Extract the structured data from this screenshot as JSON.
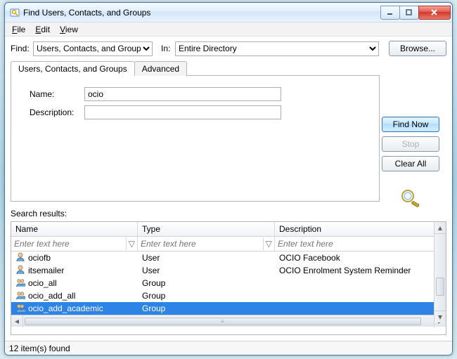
{
  "window": {
    "title": "Find Users, Contacts, and Groups"
  },
  "menu": {
    "file": "File",
    "edit": "Edit",
    "view": "View"
  },
  "find": {
    "label": "Find:",
    "value": "Users, Contacts, and Groups",
    "in_label": "In:",
    "in_value": "Entire Directory",
    "browse": "Browse..."
  },
  "tabs": {
    "main": "Users, Contacts, and Groups",
    "advanced": "Advanced"
  },
  "fields": {
    "name_label": "Name:",
    "name_value": "ocio",
    "desc_label": "Description:",
    "desc_value": ""
  },
  "buttons": {
    "find_now": "Find Now",
    "stop": "Stop",
    "clear_all": "Clear All"
  },
  "search_results_label": "Search results:",
  "columns": {
    "name": "Name",
    "type": "Type",
    "desc": "Description"
  },
  "filters": {
    "placeholder": "Enter text here"
  },
  "rows": [
    {
      "name": "ociofb",
      "type": "User",
      "desc": "OCIO Facebook",
      "icon": "user",
      "selected": false
    },
    {
      "name": "itsemailer",
      "type": "User",
      "desc": "OCIO Enrolment System Reminder",
      "icon": "user",
      "selected": false
    },
    {
      "name": "ocio_all",
      "type": "Group",
      "desc": "",
      "icon": "group",
      "selected": false
    },
    {
      "name": "ocio_add_all",
      "type": "Group",
      "desc": "",
      "icon": "group",
      "selected": false
    },
    {
      "name": "ocio_add_academic",
      "type": "Group",
      "desc": "",
      "icon": "group",
      "selected": true
    }
  ],
  "status": "12 item(s) found"
}
